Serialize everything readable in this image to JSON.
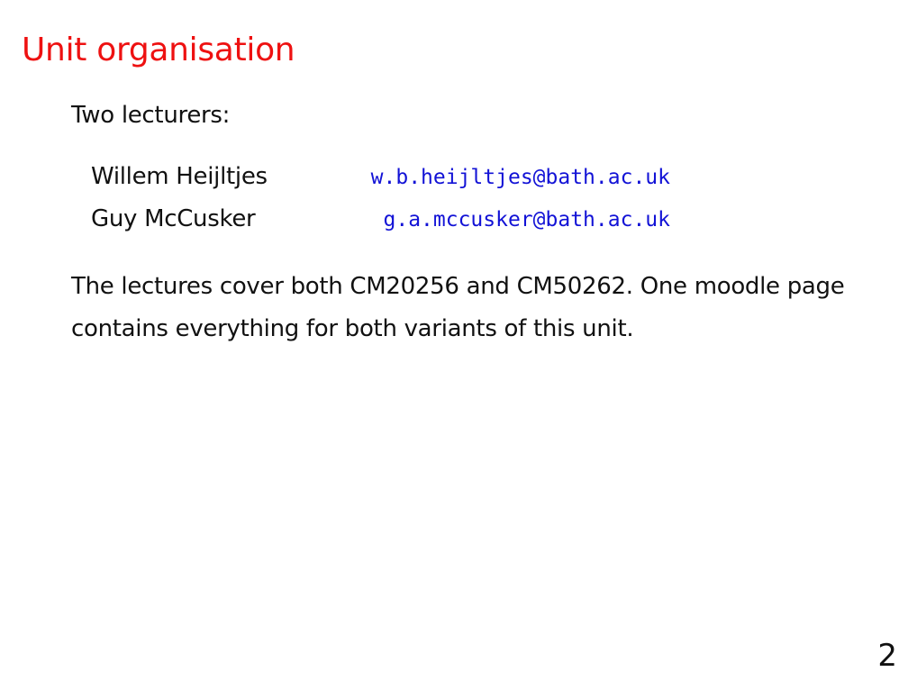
{
  "slide": {
    "title": "Unit organisation",
    "intro": "Two lecturers:",
    "lecturers": [
      {
        "name": "Willem Heijltjes",
        "email": "w.b.heijltjes@bath.ac.uk"
      },
      {
        "name": "Guy McCusker",
        "email": "g.a.mccusker@bath.ac.uk"
      }
    ],
    "body_line_1": "The lectures cover both CM20256 and CM50262. One moodle page",
    "body_line_2": "contains everything for both variants of this unit.",
    "page_number": "2"
  },
  "colors": {
    "title": "#ee1111",
    "email": "#1212d6",
    "text": "#111111",
    "background": "#ffffff"
  }
}
